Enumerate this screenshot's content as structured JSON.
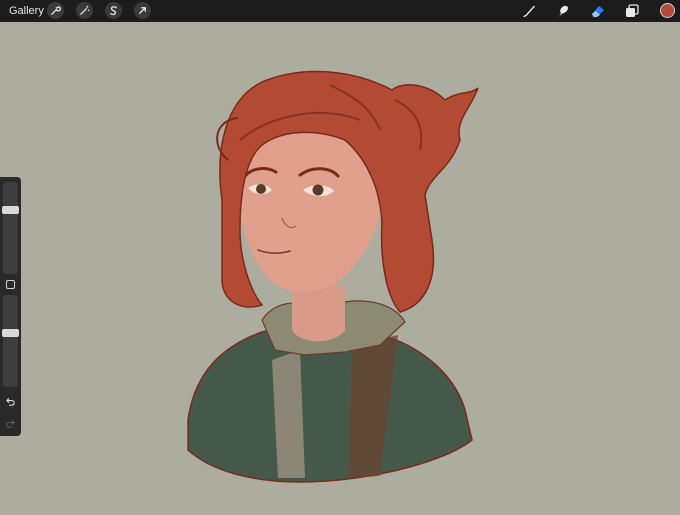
{
  "toolbar": {
    "gallery_label": "Gallery",
    "left_tools": [
      "wrench-icon",
      "magic-wand-icon",
      "selection-icon",
      "transform-arrow-icon"
    ],
    "right_tools": [
      "brush-icon",
      "smudge-icon",
      "eraser-icon",
      "layers-icon"
    ],
    "active_tool": "eraser-icon",
    "accent_color": "#2f7cf6",
    "current_color": "#b24a3a"
  },
  "sidebar": {
    "brush_size_level": 0.72,
    "opacity_level": 0.6,
    "buttons": [
      "modifier-square-icon",
      "undo-icon",
      "redo-icon"
    ]
  },
  "canvas": {
    "background_color": "#adad9f",
    "hair_color": "#b24a34",
    "jacket_color": "#45594a"
  }
}
